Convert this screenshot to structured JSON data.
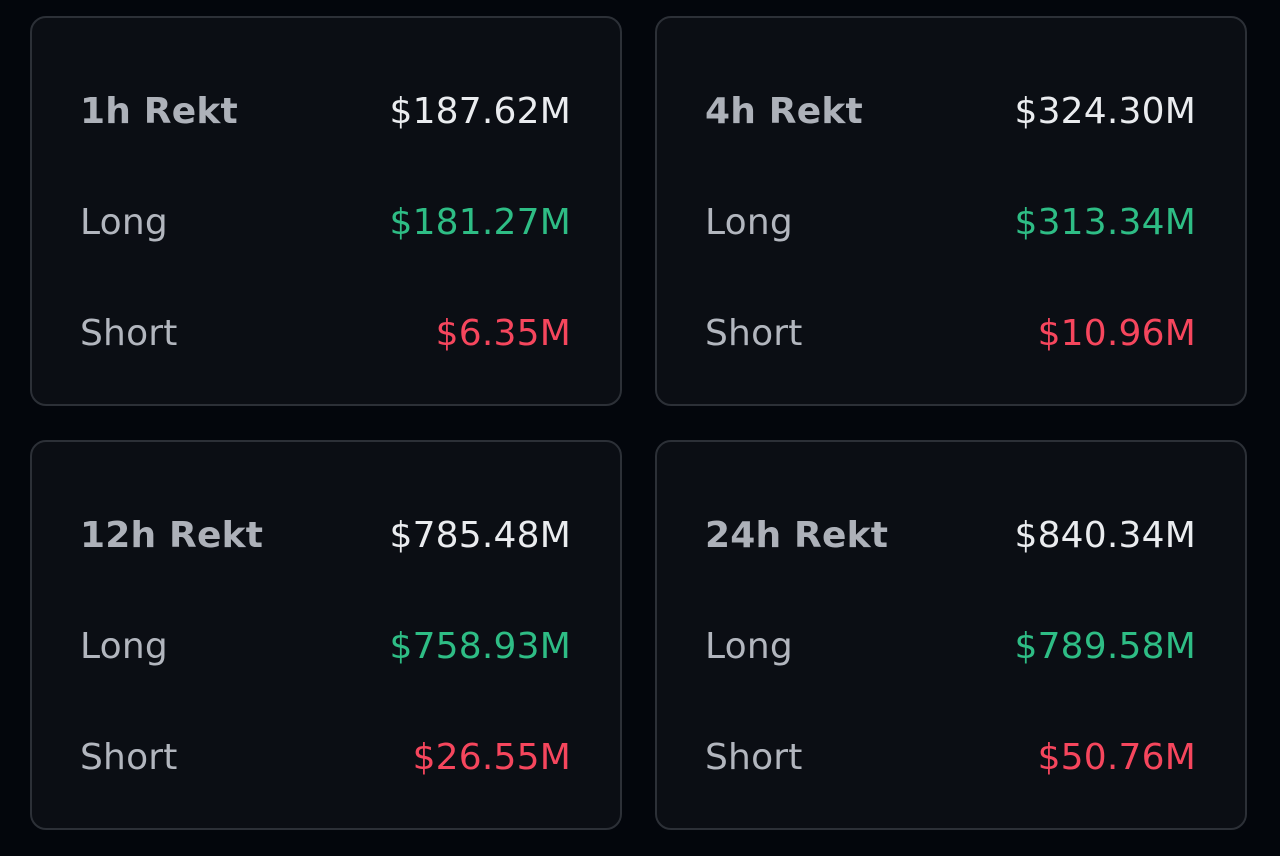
{
  "colors": {
    "background": "#03060c",
    "card_background": "#0b0e14",
    "card_border": "#2c3037",
    "label": "#b2b6be",
    "total": "#eaecef",
    "long": "#2ebd85",
    "short": "#f6465d"
  },
  "cards": [
    {
      "title": "1h Rekt",
      "total": "$187.62M",
      "long_label": "Long",
      "long": "$181.27M",
      "short_label": "Short",
      "short": "$6.35M"
    },
    {
      "title": "4h Rekt",
      "total": "$324.30M",
      "long_label": "Long",
      "long": "$313.34M",
      "short_label": "Short",
      "short": "$10.96M"
    },
    {
      "title": "12h Rekt",
      "total": "$785.48M",
      "long_label": "Long",
      "long": "$758.93M",
      "short_label": "Short",
      "short": "$26.55M"
    },
    {
      "title": "24h Rekt",
      "total": "$840.34M",
      "long_label": "Long",
      "long": "$789.58M",
      "short_label": "Short",
      "short": "$50.76M"
    }
  ]
}
